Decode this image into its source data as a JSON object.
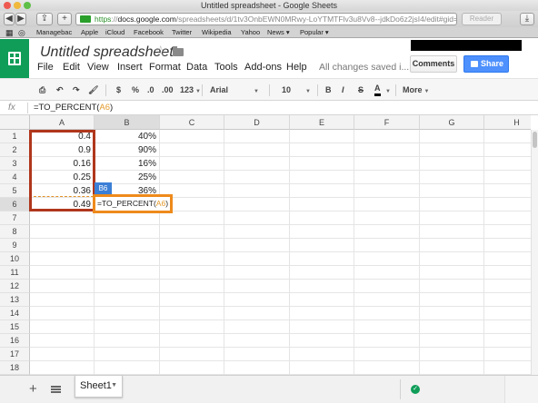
{
  "window": {
    "title": "Untitled spreadsheet - Google Sheets"
  },
  "browser": {
    "url_scheme": "https",
    "url_host": "docs.google.com",
    "url_path": "/spreadsheets/d/1tv3OnbEWN0MRwy-LoYTMTFlv3u8Vv8--jdkDo6z2jsI4/edit#gid=0",
    "reader_label": "Reader",
    "bookmarks": [
      "Managebac",
      "Apple",
      "iCloud",
      "Facebook",
      "Twitter",
      "Wikipedia",
      "Yahoo",
      "News ▾",
      "Popular ▾"
    ]
  },
  "doc": {
    "title": "Untitled spreadsheet",
    "menus": [
      "File",
      "Edit",
      "View",
      "Insert",
      "Format",
      "Data",
      "Tools",
      "Add-ons",
      "Help"
    ],
    "save_status": "All changes saved i...",
    "comments_label": "Comments",
    "share_label": "Share"
  },
  "toolbar": {
    "currency": "$",
    "percent": "%",
    "dec_decrease": ".0",
    "dec_increase": ".00",
    "number_format": "123",
    "font": "Arial",
    "font_size": "10",
    "bold": "B",
    "italic": "I",
    "strike": "S",
    "text_color": "A",
    "more": "More"
  },
  "formula_bar": {
    "fx": "fx",
    "prefix": "=TO_PERCENT(",
    "ref": "A6",
    "suffix": ")"
  },
  "grid": {
    "columns": [
      "A",
      "B",
      "C",
      "D",
      "E",
      "F",
      "G",
      "H"
    ],
    "rows": [
      "1",
      "2",
      "3",
      "4",
      "5",
      "6",
      "7",
      "8",
      "9",
      "10",
      "11",
      "12",
      "13",
      "14",
      "15",
      "16",
      "17",
      "18"
    ],
    "col_a": [
      "0.4",
      "0.9",
      "0.16",
      "0.25",
      "0.36",
      "0.49"
    ],
    "col_b": [
      "40%",
      "90%",
      "16%",
      "25%",
      "36%"
    ],
    "ref_tag": "B6",
    "editing_prefix": "=TO_PERCENT(",
    "editing_ref": "A6",
    "editing_suffix": ")"
  },
  "bottom": {
    "add_sheet": "+",
    "sheet_tab": "Sheet1"
  },
  "colors": {
    "sheets_green": "#0f9d58",
    "share_blue": "#4d90fe",
    "annotation_red": "#b0361c",
    "annotation_orange": "#ee8a1b",
    "ref_tag_blue": "#3b7fd6"
  }
}
